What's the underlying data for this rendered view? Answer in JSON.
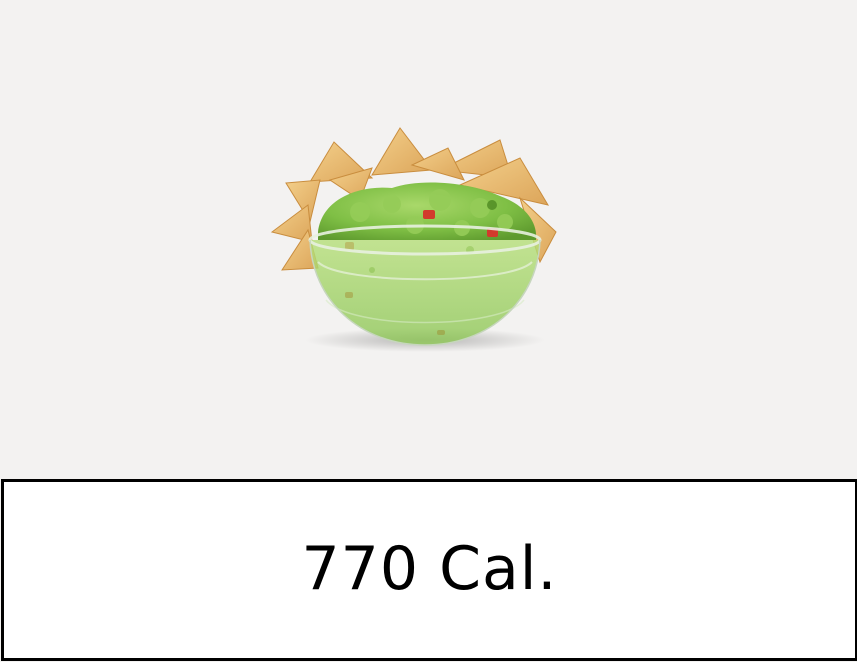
{
  "product": {
    "image_icon": "chips-and-guacamole-photo",
    "calories_label": "770 Cal."
  },
  "colors": {
    "background": "#f3f2f1",
    "box_background": "#ffffff",
    "box_border": "#000000",
    "text": "#000000"
  }
}
